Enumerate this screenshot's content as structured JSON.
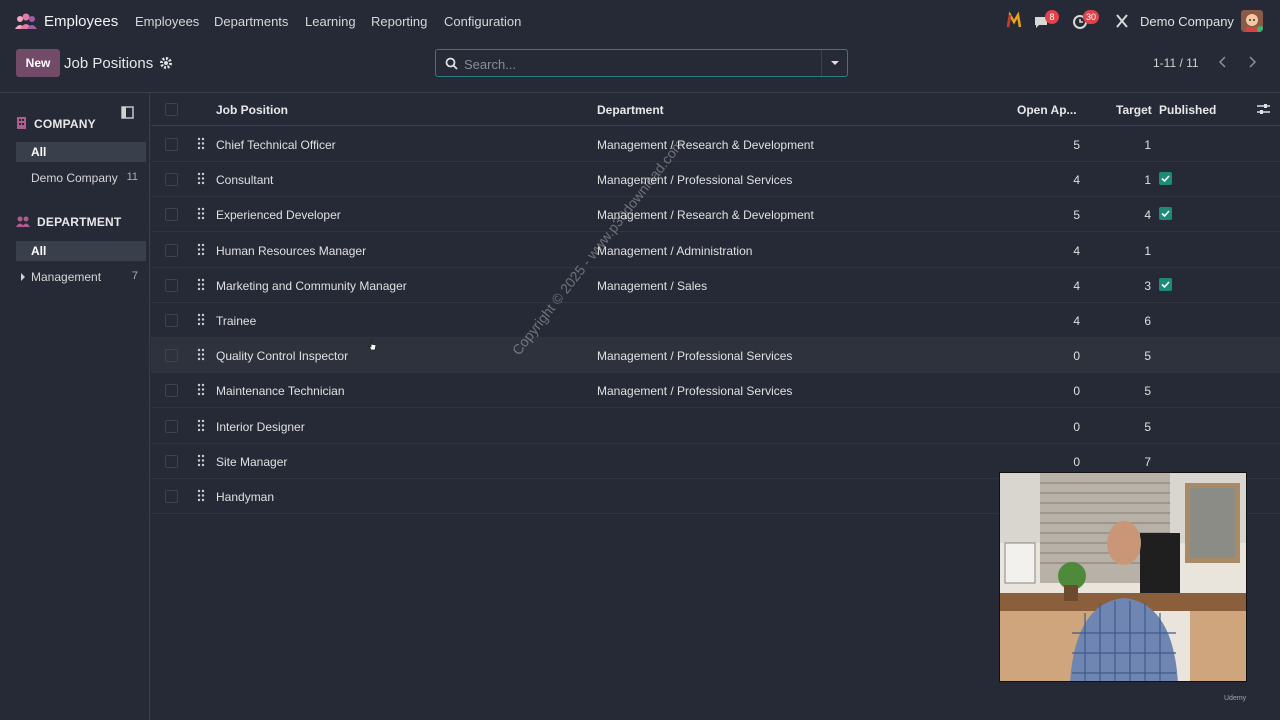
{
  "app": {
    "name": "Employees"
  },
  "menu": [
    "Employees",
    "Departments",
    "Learning",
    "Reporting",
    "Configuration"
  ],
  "systray": {
    "messages_badge": "8",
    "activity_badge": "30",
    "company": "Demo Company"
  },
  "control": {
    "new_label": "New",
    "title": "Job Positions",
    "search_placeholder": "Search...",
    "pager": "1-11 / 11"
  },
  "sidebar": {
    "company_heading": "COMPANY",
    "company_items": [
      {
        "label": "All",
        "count": ""
      },
      {
        "label": "Demo Company",
        "count": "11"
      }
    ],
    "department_heading": "DEPARTMENT",
    "department_items": [
      {
        "label": "All",
        "count": ""
      },
      {
        "label": "Management",
        "count": "7"
      }
    ]
  },
  "table": {
    "headers": {
      "job": "Job Position",
      "dept": "Department",
      "open": "Open Ap...",
      "target": "Target",
      "published": "Published"
    },
    "rows": [
      {
        "job": "Chief Technical Officer",
        "dept": "Management / Research & Development",
        "open": "5",
        "target": "1",
        "published": false
      },
      {
        "job": "Consultant",
        "dept": "Management / Professional Services",
        "open": "4",
        "target": "1",
        "published": true
      },
      {
        "job": "Experienced Developer",
        "dept": "Management / Research & Development",
        "open": "5",
        "target": "4",
        "published": true
      },
      {
        "job": "Human Resources Manager",
        "dept": "Management / Administration",
        "open": "4",
        "target": "1",
        "published": false
      },
      {
        "job": "Marketing and Community Manager",
        "dept": "Management / Sales",
        "open": "4",
        "target": "3",
        "published": true
      },
      {
        "job": "Trainee",
        "dept": "",
        "open": "4",
        "target": "6",
        "published": false
      },
      {
        "job": "Quality Control Inspector",
        "dept": "Management / Professional Services",
        "open": "0",
        "target": "5",
        "published": false
      },
      {
        "job": "Maintenance Technician",
        "dept": "Management / Professional Services",
        "open": "0",
        "target": "5",
        "published": false
      },
      {
        "job": "Interior Designer",
        "dept": "",
        "open": "0",
        "target": "5",
        "published": false
      },
      {
        "job": "Site Manager",
        "dept": "",
        "open": "0",
        "target": "7",
        "published": false
      },
      {
        "job": "Handyman",
        "dept": "",
        "open": "",
        "target": "",
        "published": false
      }
    ]
  },
  "watermark": "Copyright © 2025 - www.p30download.com",
  "udemy": "Udemy",
  "colors": {
    "brand": "#714B67",
    "accent": "#1E8A7A",
    "badge": "#E0424A"
  }
}
